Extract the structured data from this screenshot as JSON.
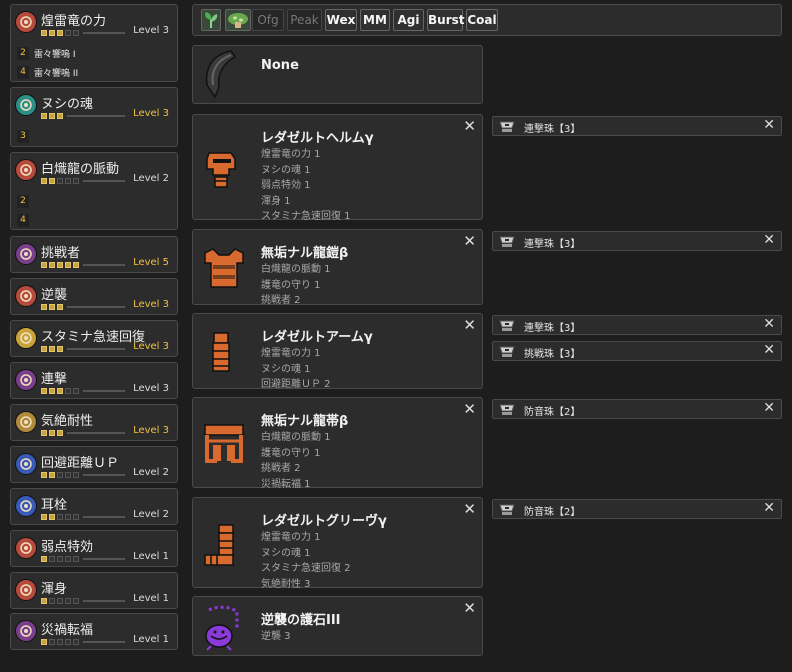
{
  "colors": {
    "background": "#1d1d1d",
    "panel": "#2c2c2c",
    "border": "#4a4a4a",
    "max_level": "#f0c040",
    "pip_filled": "#c8a23a",
    "armor_orange": "#d86a30",
    "charm_purple": "#8a3ad8"
  },
  "skills": [
    {
      "name": "煌雷竜の力",
      "level": "Level 3",
      "filled": 3,
      "total": 5,
      "max": false,
      "icon": "dragon-head-icon",
      "icon_color": "#b64a3c",
      "decorations": [
        {
          "size": "2",
          "name": "雷々響嗚 I"
        },
        {
          "size": "4",
          "name": "雷々響嗚 II"
        }
      ]
    },
    {
      "name": "ヌシの魂",
      "level": "Level 3",
      "filled": 3,
      "total": 3,
      "max": true,
      "icon": "spirit-icon",
      "icon_color": "#2a8f86",
      "decorations": [
        {
          "size": "3",
          "name": ""
        }
      ]
    },
    {
      "name": "白熾龍の脈動",
      "level": "Level 2",
      "filled": 2,
      "total": 5,
      "max": false,
      "icon": "dragon-head-icon",
      "icon_color": "#b64a3c",
      "decorations": [
        {
          "size": "2",
          "name": ""
        },
        {
          "size": "4",
          "name": ""
        }
      ]
    },
    {
      "name": "挑戦者",
      "level": "Level 5",
      "filled": 5,
      "total": 5,
      "max": true,
      "icon": "claw-icon",
      "icon_color": "#7a3f8a",
      "decorations": []
    },
    {
      "name": "逆襲",
      "level": "Level 3",
      "filled": 3,
      "total": 3,
      "max": true,
      "icon": "fist-icon",
      "icon_color": "#b64a3c",
      "decorations": []
    },
    {
      "name": "スタミナ急速回復",
      "level": "Level 3",
      "filled": 3,
      "total": 3,
      "max": true,
      "icon": "diamond-icon",
      "icon_color": "#c8a23a",
      "decorations": []
    },
    {
      "name": "連撃",
      "level": "Level 3",
      "filled": 3,
      "total": 5,
      "max": false,
      "icon": "claw-icon",
      "icon_color": "#7a3f8a",
      "decorations": []
    },
    {
      "name": "気絶耐性",
      "level": "Level 3",
      "filled": 3,
      "total": 3,
      "max": true,
      "icon": "shield-icon",
      "icon_color": "#b08a3c",
      "decorations": []
    },
    {
      "name": "回避距離ＵＰ",
      "level": "Level 2",
      "filled": 2,
      "total": 5,
      "max": false,
      "icon": "boot-icon",
      "icon_color": "#3a5ab8",
      "decorations": []
    },
    {
      "name": "耳栓",
      "level": "Level 2",
      "filled": 2,
      "total": 5,
      "max": false,
      "icon": "boot-icon",
      "icon_color": "#3a5ab8",
      "decorations": []
    },
    {
      "name": "弱点特効",
      "level": "Level 1",
      "filled": 1,
      "total": 5,
      "max": false,
      "icon": "fist-icon",
      "icon_color": "#b64a3c",
      "decorations": []
    },
    {
      "name": "渾身",
      "level": "Level 1",
      "filled": 1,
      "total": 5,
      "max": false,
      "icon": "fist-icon",
      "icon_color": "#b64a3c",
      "decorations": []
    },
    {
      "name": "災禍転福",
      "level": "Level 1",
      "filled": 1,
      "total": 5,
      "max": false,
      "icon": "claw-icon",
      "icon_color": "#7a3f8a",
      "decorations": []
    }
  ],
  "toolbar": {
    "icons": [
      "plant-icon",
      "mushroom-icon"
    ],
    "buttons": [
      {
        "label": "Ofg",
        "active": false
      },
      {
        "label": "Peak",
        "active": false
      },
      {
        "label": "Wex",
        "active": true
      },
      {
        "label": "MM",
        "active": true
      },
      {
        "label": "Agi",
        "active": true
      },
      {
        "label": "Burst",
        "active": true
      },
      {
        "label": "Coal",
        "active": true
      }
    ]
  },
  "weapon": {
    "name": "None",
    "icon": "greatsword-icon"
  },
  "armor": [
    {
      "name": "レダゼルトヘルムγ",
      "icon": "helmet-icon",
      "skills": [
        "煌雷竜の力 1",
        "ヌシの魂 1",
        "弱点特効 1",
        "渾身 1",
        "スタミナ急速回復 1"
      ],
      "slots": [
        {
          "name": "連撃珠【3】"
        }
      ]
    },
    {
      "name": "無垢ナル龍鎧β",
      "icon": "chest-icon",
      "skills": [
        "白熾龍の脈動 1",
        "護竜の守り 1",
        "挑戦者 2"
      ],
      "slots": [
        {
          "name": "連撃珠【3】"
        }
      ]
    },
    {
      "name": "レダゼルトアームγ",
      "icon": "arm-icon",
      "skills": [
        "煌雷竜の力 1",
        "ヌシの魂 1",
        "回避距離ＵＰ 2"
      ],
      "slots": [
        {
          "name": "連撃珠【3】"
        },
        {
          "name": "挑戦珠【3】"
        }
      ]
    },
    {
      "name": "無垢ナル龍帯β",
      "icon": "waist-icon",
      "skills": [
        "白熾龍の脈動 1",
        "護竜の守り 1",
        "挑戦者 2",
        "災禍転福 1"
      ],
      "slots": [
        {
          "name": "防音珠【2】"
        }
      ]
    },
    {
      "name": "レダゼルトグリーヴγ",
      "icon": "leg-icon",
      "skills": [
        "煌雷竜の力 1",
        "ヌシの魂 1",
        "スタミナ急速回復 2",
        "気絶耐性 3"
      ],
      "slots": [
        {
          "name": "防音珠【2】"
        }
      ]
    },
    {
      "name": "逆襲の護石III",
      "icon": "charm-icon",
      "skills": [
        "逆襲 3"
      ],
      "slots": []
    }
  ],
  "close_glyph": "✕"
}
